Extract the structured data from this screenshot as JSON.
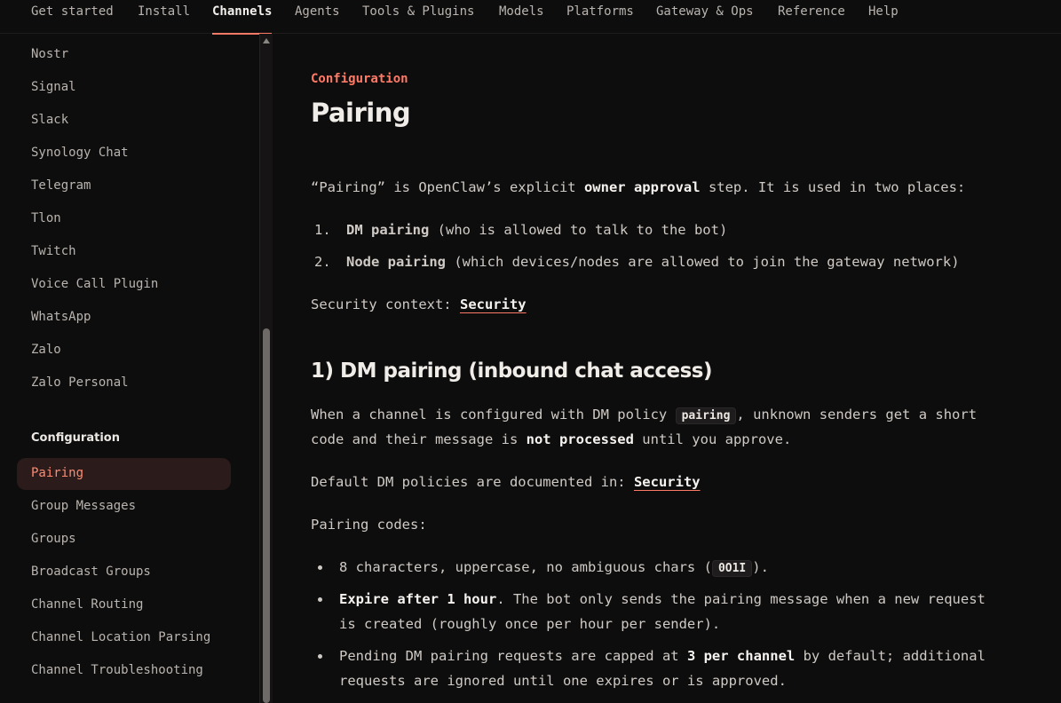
{
  "topnav": {
    "tabs": [
      {
        "label": "Get started",
        "active": false
      },
      {
        "label": "Install",
        "active": false
      },
      {
        "label": "Channels",
        "active": true
      },
      {
        "label": "Agents",
        "active": false
      },
      {
        "label": "Tools & Plugins",
        "active": false
      },
      {
        "label": "Models",
        "active": false
      },
      {
        "label": "Platforms",
        "active": false
      },
      {
        "label": "Gateway & Ops",
        "active": false
      },
      {
        "label": "Reference",
        "active": false
      },
      {
        "label": "Help",
        "active": false
      }
    ]
  },
  "sidebar": {
    "items_top": [
      "Nostr",
      "Signal",
      "Slack",
      "Synology Chat",
      "Telegram",
      "Tlon",
      "Twitch",
      "Voice Call Plugin",
      "WhatsApp",
      "Zalo",
      "Zalo Personal"
    ],
    "section_title": "Configuration",
    "items_config": [
      "Pairing",
      "Group Messages",
      "Groups",
      "Broadcast Groups",
      "Channel Routing",
      "Channel Location Parsing",
      "Channel Troubleshooting"
    ],
    "active_item": "Pairing"
  },
  "content": {
    "eyebrow": "Configuration",
    "title": "Pairing",
    "intro": {
      "pre": "“Pairing” is OpenClaw’s explicit ",
      "bold": "owner approval",
      "post": " step. It is used in two places:"
    },
    "ordered_list": [
      {
        "num": "1.",
        "bold": "DM pairing",
        "rest": " (who is allowed to talk to the bot)"
      },
      {
        "num": "2.",
        "bold": "Node pairing",
        "rest": " (which devices/nodes are allowed to join the gateway network)"
      }
    ],
    "security_context": {
      "label": "Security context: ",
      "link": "Security"
    },
    "section_heading": "1) DM pairing (inbound chat access)",
    "para1": {
      "line1_pre": "When a channel is configured with DM policy ",
      "code": "pairing",
      "line1_post": ", unknown senders get a short",
      "line2_pre": "code and their message is ",
      "bold": "not processed",
      "line2_post": " until you approve."
    },
    "default_policies": {
      "label": "Default DM policies are documented in: ",
      "link": "Security"
    },
    "pairing_codes_label": "Pairing codes:",
    "bullets": {
      "b1_pre": "8 characters, uppercase, no ambiguous chars (",
      "b1_code": "0O1I",
      "b1_post": ").",
      "b2_bold": "Expire after 1 hour",
      "b2_line1": ". The bot only sends the pairing message when a new request",
      "b2_line2": "is created (roughly once per hour per sender).",
      "b3_pre": "Pending DM pairing requests are capped at ",
      "b3_bold": "3 per channel",
      "b3_post": " by default; additional",
      "b3_line2": "requests are ignored until one expires or is approved."
    }
  },
  "colors": {
    "accent": "#ff7a66",
    "background": "#0e0d0d",
    "active_bg": "#2b1c1b"
  }
}
